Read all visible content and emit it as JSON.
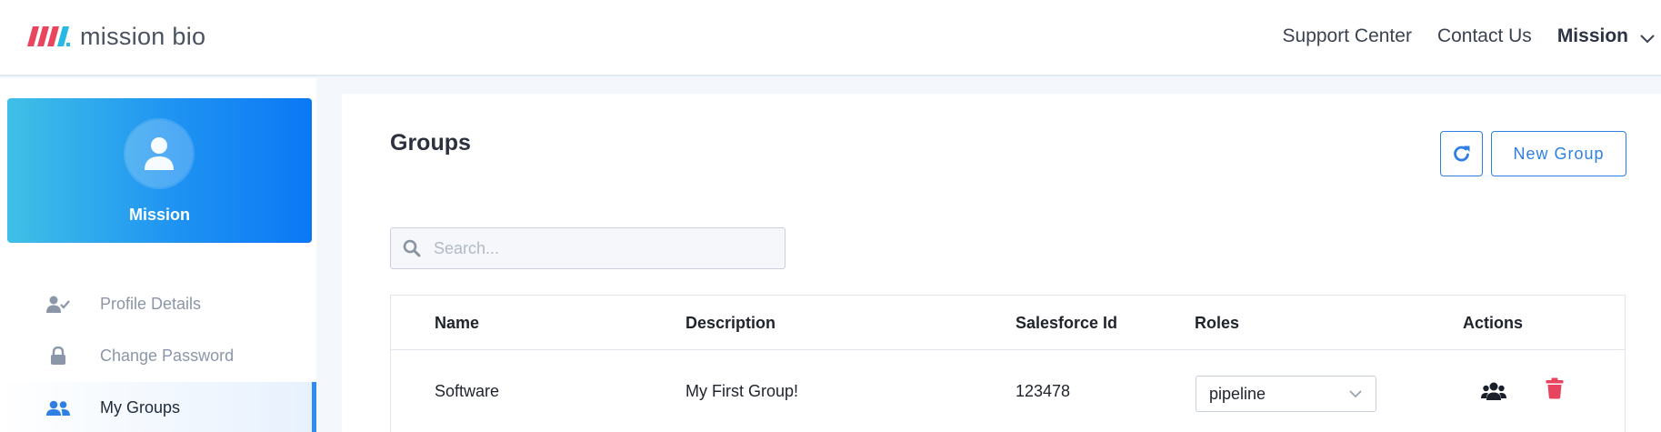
{
  "header": {
    "logo_text": "mission bio",
    "nav": [
      "Support Center",
      "Contact Us"
    ],
    "user_name": "Mission"
  },
  "sidebar": {
    "profile_name": "Mission",
    "items": [
      {
        "label": "Profile Details",
        "icon": "user-check-icon",
        "active": false
      },
      {
        "label": "Change Password",
        "icon": "lock-icon",
        "active": false
      },
      {
        "label": "My Groups",
        "icon": "users-icon",
        "active": true
      }
    ]
  },
  "main": {
    "title": "Groups",
    "new_group_label": "New Group",
    "search_placeholder": "Search...",
    "table": {
      "headers": [
        "Name",
        "Description",
        "Salesforce Id",
        "Roles",
        "Actions"
      ],
      "rows": [
        {
          "name": "Software",
          "description": "My First Group!",
          "salesforce_id": "123478",
          "role": "pipeline"
        }
      ]
    }
  },
  "colors": {
    "accent": "#2d7fe3",
    "delete": "#e8445f",
    "gradient_start": "#3fc0e6",
    "gradient_end": "#0a78f5"
  }
}
